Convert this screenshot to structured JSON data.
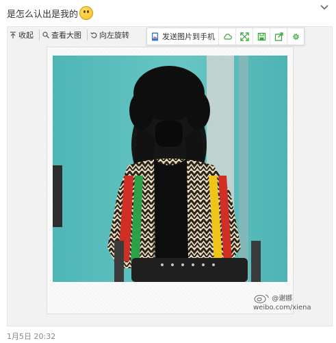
{
  "post": {
    "text": "是怎么认出是我的",
    "timestamp": "1月5日 20:32"
  },
  "toolbar": {
    "collapse_label": "收起",
    "view_large_label": "查看大图",
    "rotate_left_label": "向左旋转"
  },
  "float_bar": {
    "send_to_phone_label": "发送图片到手机"
  },
  "watermark": {
    "handle": "@谢娜",
    "url": "weibo.com/xiena"
  },
  "colors": {
    "float_icon_green": "#3aa53a",
    "photo_bg": "#5bbcbc"
  }
}
